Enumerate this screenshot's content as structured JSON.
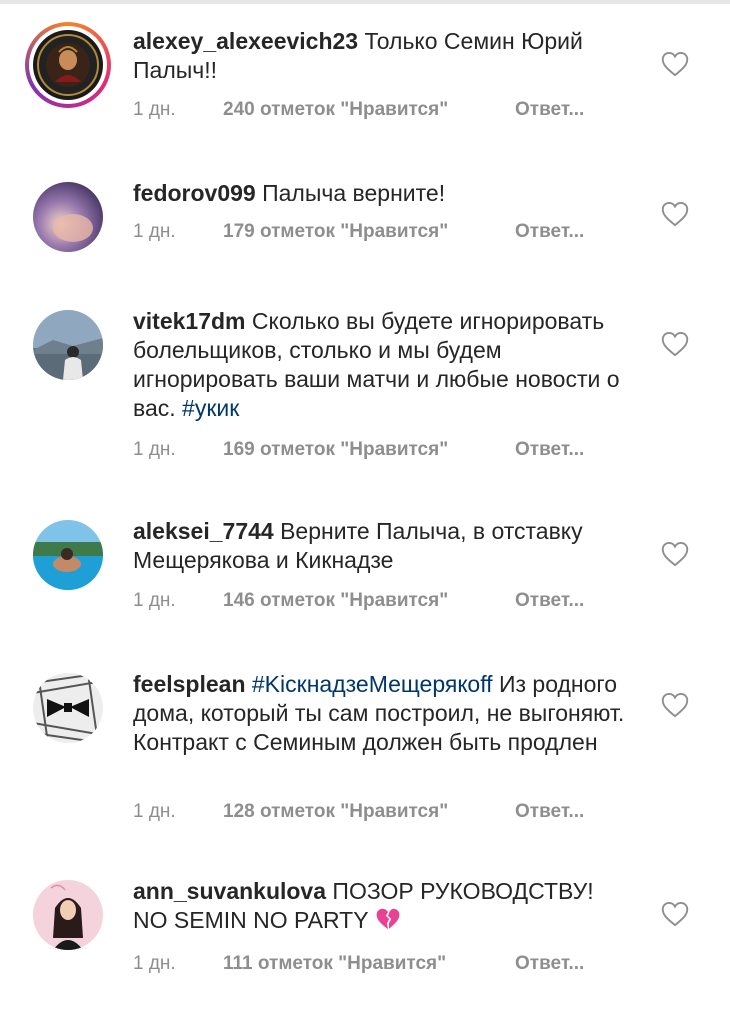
{
  "comments": [
    {
      "username": "alexey_alexeevich23",
      "text": "Только Семин Юрий Палыч!!",
      "time": "1 дн.",
      "likes": "240 отметок \"Нравится\"",
      "reply": "Ответ..."
    },
    {
      "username": "fedorov099",
      "text": "Палыча верните!",
      "time": "1 дн.",
      "likes": "179 отметок \"Нравится\"",
      "reply": "Ответ..."
    },
    {
      "username": "vitek17dm",
      "text": "Сколько вы будете игнорировать болельщиков, столько и мы будем игнорировать ваши матчи и любые новости о вас.",
      "hashtag": "#укик",
      "time": "1 дн.",
      "likes": "169 отметок \"Нравится\"",
      "reply": "Ответ..."
    },
    {
      "username": "aleksei_7744",
      "text": "Верните Палыча, в отставку Мещерякова и Кикнадзе",
      "time": "1 дн.",
      "likes": "146 отметок \"Нравится\"",
      "reply": "Ответ..."
    },
    {
      "username": "feelsplean",
      "hashtag": "#KicкнадзеМещерякoff",
      "text": "Из родного дома, который ты сам построил, не выгоняют. Контракт с Семиным должен быть продлен",
      "time": "1 дн.",
      "likes": "128 отметок \"Нравится\"",
      "reply": "Ответ..."
    },
    {
      "username": "ann_suvankulova",
      "text": "ПОЗОР РУКОВОДСТВУ! NO SEMIN NO PARTY",
      "emoji": "💔",
      "time": "1 дн.",
      "likes": "111 отметок \"Нравится\"",
      "reply": "Ответ..."
    }
  ],
  "colors": {
    "text": "#262626",
    "meta": "#8e8e8e",
    "hashtag": "#00376b",
    "heart": "#8e8e8e",
    "emoji_heart": "#e84393"
  },
  "icons": {
    "like": "heart-outline-icon",
    "broken_heart": "broken-heart-emoji"
  }
}
